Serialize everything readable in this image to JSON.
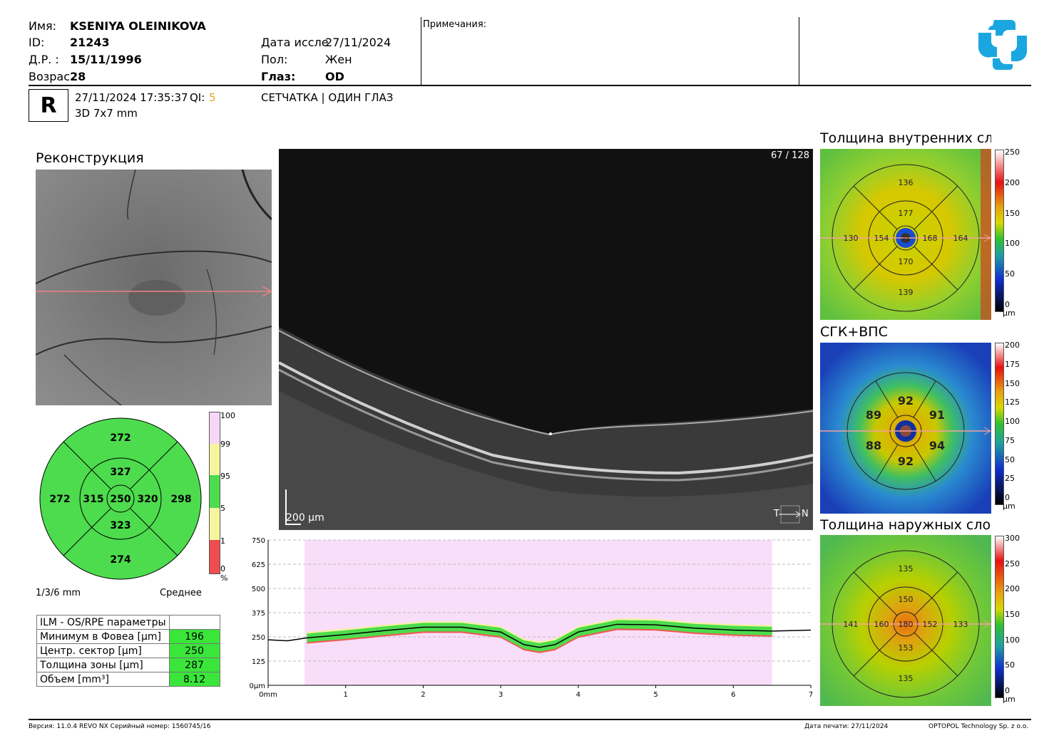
{
  "patient": {
    "name_label": "Имя:",
    "name": "KSENIYA OLEINIKOVA",
    "id_label": "ID:",
    "id": "21243",
    "dob_label": "Д.Р. :",
    "dob": "15/11/1996",
    "age_label": "Возрас",
    "age": "28",
    "exam_date_label": "Дата иссле",
    "exam_date": "27/11/2024",
    "sex_label": "Пол:",
    "sex": "Жен",
    "eye_label": "Глаз:",
    "eye": "OD",
    "notes_label": "Примечания:"
  },
  "scan": {
    "eye_badge": "R",
    "datetime": "27/11/2024 17:35:37",
    "qi_label": "QI:",
    "qi_value": "5",
    "protocol": "3D  7x7 mm",
    "mode": "СЕТЧАТКА | ОДИН ГЛАЗ",
    "slice": "67 / 128",
    "scale": "200 µm",
    "orientation_t": "T",
    "orientation_n": "N"
  },
  "reconstruction": {
    "title": "Реконструкция"
  },
  "etdrs_main": {
    "outer": {
      "top": "272",
      "left": "272",
      "right": "298",
      "bottom": "274"
    },
    "inner": {
      "top": "327",
      "left": "315",
      "right": "320",
      "bottom": "323"
    },
    "center": "250",
    "ring_label": "1/3/6 mm",
    "mode_label": "Среднее"
  },
  "percentile_scale": {
    "ticks": [
      "100",
      "99",
      "95",
      "5",
      "1",
      "0"
    ],
    "unit": "%",
    "colors": [
      "#f7d7f7",
      "#f5f5a0",
      "#4ddc4d",
      "#f5f5a0",
      "#ef4d4d"
    ]
  },
  "params_table": {
    "title": "ILM - OS/RPE параметры",
    "rows": [
      {
        "label": "Минимум в Фовеа [µm]",
        "value": "196"
      },
      {
        "label": "Центр. сектор [µm]",
        "value": "250"
      },
      {
        "label": "Толщина зоны [µm]",
        "value": "287"
      },
      {
        "label": "Объем [mm³]",
        "value": "8.12"
      }
    ]
  },
  "profile_chart": {
    "y_ticks": [
      "750",
      "625",
      "500",
      "375",
      "250",
      "125",
      "0µm"
    ],
    "x_ticks": [
      "0mm",
      "1",
      "2",
      "3",
      "4",
      "5",
      "6",
      "7"
    ]
  },
  "chart_data": {
    "type": "line",
    "xlabel": "",
    "ylabel": "",
    "xlim": [
      0,
      7
    ],
    "ylim": [
      0,
      750
    ],
    "x": [
      0,
      0.25,
      0.5,
      1,
      1.5,
      2,
      2.5,
      3,
      3.3,
      3.5,
      3.7,
      4,
      4.5,
      5,
      5.5,
      6,
      6.5,
      7
    ],
    "series": [
      {
        "values": [
          235,
          230,
          245,
          262,
          282,
          300,
          300,
          275,
          210,
          196,
          210,
          275,
          315,
          312,
          295,
          285,
          280,
          285
        ]
      }
    ]
  },
  "inner_map": {
    "title": "Толщина внутренних сло",
    "values": {
      "top": "136",
      "inner_top": "177",
      "left": "130",
      "inner_left": "154",
      "center": "71",
      "inner_right": "168",
      "right": "164",
      "inner_bottom": "170",
      "bottom": "139"
    },
    "scale_ticks": [
      "250",
      "200",
      "150",
      "100",
      "50",
      "0"
    ],
    "unit": "µm"
  },
  "gcl_map": {
    "title": "СГК+ВПС",
    "values": {
      "top": "92",
      "top_left": "89",
      "top_right": "91",
      "bottom_left": "88",
      "bottom_right": "94",
      "bottom": "92"
    },
    "scale_ticks": [
      "200",
      "175",
      "150",
      "125",
      "100",
      "75",
      "50",
      "25",
      "0"
    ],
    "unit": "µm"
  },
  "outer_map": {
    "title": "Толщина наружных слое",
    "values": {
      "top": "135",
      "inner_top": "150",
      "left": "141",
      "inner_left": "160",
      "center": "180",
      "inner_right": "152",
      "right": "133",
      "inner_bottom": "153",
      "bottom": "135"
    },
    "scale_ticks": [
      "300",
      "250",
      "200",
      "150",
      "100",
      "50",
      "0"
    ],
    "unit": "µm"
  },
  "footer": {
    "version": "Версия: 11.0.4    REVO NX    Серийный номер: 1560745/16",
    "print_date": "Дата печати: 27/11/2024",
    "company": "OPTOPOL Technology Sp. z o.o."
  }
}
